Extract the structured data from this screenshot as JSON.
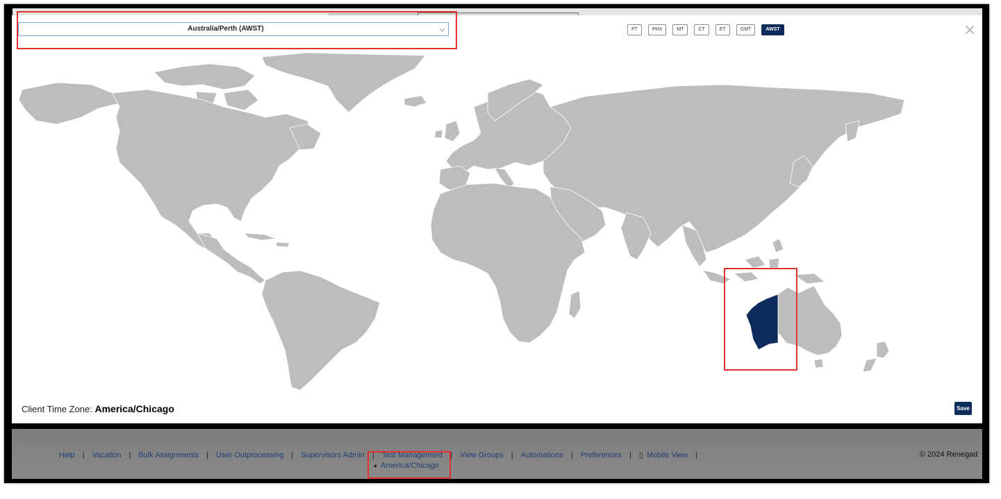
{
  "timezone_select": {
    "value": "Australia/Perth (AWST)"
  },
  "quick_zones": [
    "PT",
    "PHX",
    "MT",
    "CT",
    "ET",
    "GMT",
    "AWST"
  ],
  "active_zone": "AWST",
  "close_icon": "close-icon",
  "map": {
    "highlighted_region": "Western Australia",
    "highlight_color": "#0d2c5c",
    "land_color": "#bdbdbd"
  },
  "client_time_zone": {
    "label": "Client Time Zone:",
    "value": "America/Chicago"
  },
  "save_label": "Save",
  "footer": {
    "links": [
      "Help",
      "Vacation",
      "Bulk Assignments",
      "User Outprocessing",
      "Supervisors Admin",
      "Test Management",
      "View Groups",
      "Automations",
      "Preferences",
      "Mobile View"
    ],
    "mobile_icon": "mobile-icon",
    "timezone": "America/Chicago",
    "globe_icon": "globe-icon",
    "copyright": "© 2024 Renegad"
  }
}
